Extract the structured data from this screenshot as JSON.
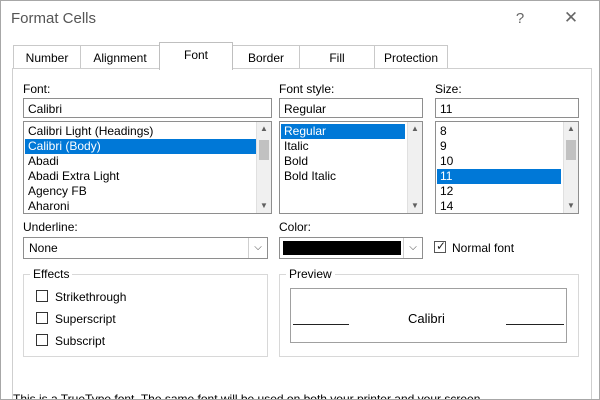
{
  "window": {
    "title": "Format Cells",
    "help": "?",
    "close": "✕"
  },
  "tabs": [
    {
      "label": "Number"
    },
    {
      "label": "Alignment"
    },
    {
      "label": "Font",
      "active": true
    },
    {
      "label": "Border"
    },
    {
      "label": "Fill"
    },
    {
      "label": "Protection"
    }
  ],
  "font": {
    "label": "Font:",
    "value": "Calibri",
    "items": [
      "Calibri Light (Headings)",
      "Calibri (Body)",
      "Abadi",
      "Abadi Extra Light",
      "Agency FB",
      "Aharoni"
    ],
    "selected_index": 1
  },
  "font_style": {
    "label": "Font style:",
    "value": "Regular",
    "items": [
      "Regular",
      "Italic",
      "Bold",
      "Bold Italic"
    ],
    "selected_index": 0
  },
  "size": {
    "label": "Size:",
    "value": "11",
    "items": [
      "8",
      "9",
      "10",
      "11",
      "12",
      "14"
    ],
    "selected_index": 3
  },
  "underline": {
    "label": "Underline:",
    "value": "None"
  },
  "color": {
    "label": "Color:",
    "swatch": "#000000"
  },
  "normal_font": {
    "label": "Normal font",
    "checked": true
  },
  "effects": {
    "title": "Effects",
    "strikethrough": "Strikethrough",
    "superscript": "Superscript",
    "subscript": "Subscript"
  },
  "preview": {
    "title": "Preview",
    "sample": "Calibri"
  },
  "footer": "This is a TrueType font.  The same font will be used on both your printer and your screen.",
  "colors": {
    "selection": "#0078d7"
  }
}
